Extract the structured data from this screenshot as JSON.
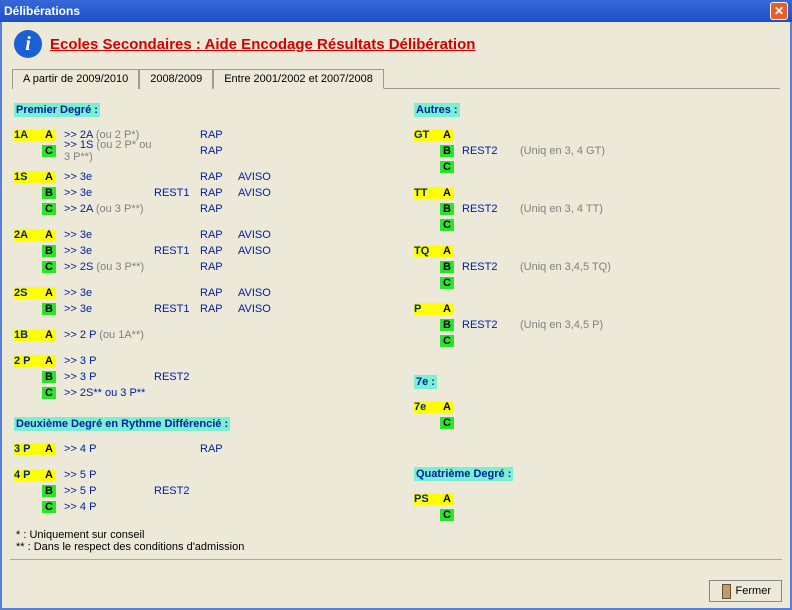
{
  "window": {
    "title": "Délibérations"
  },
  "header": {
    "title": "Ecoles Secondaires : Aide Encodage Résultats Délibération"
  },
  "tabs": {
    "t1": "A partir de 2009/2010",
    "t2": "2008/2009",
    "t3": "Entre 2001/2002 et 2007/2008"
  },
  "sections": {
    "premier": "Premier Degré :",
    "deuxieme": "Deuxième Degré en Rythme Différencié :",
    "autres": "Autres :",
    "septieme": "7e :",
    "quatrieme": "Quatrième Degré :"
  },
  "left": {
    "g1A_A": {
      "lvl": "1A",
      "L": "A",
      "dest": ">> 2A",
      "destgray": " (ou 2 P*)",
      "rest": "",
      "rap": "RAP",
      "av": ""
    },
    "g1A_C": {
      "lvl": "",
      "L": "C",
      "dest": ">> 1S",
      "destgray": " (ou 2 P* ou 3 P**)",
      "rest": "",
      "rap": "RAP",
      "av": ""
    },
    "g1S_A": {
      "lvl": "1S",
      "L": "A",
      "dest": ">> 3e",
      "destgray": "",
      "rest": "",
      "rap": "RAP",
      "av": "AVISO"
    },
    "g1S_B": {
      "lvl": "",
      "L": "B",
      "dest": ">> 3e",
      "destgray": "",
      "rest": "REST1",
      "rap": "RAP",
      "av": "AVISO"
    },
    "g1S_C": {
      "lvl": "",
      "L": "C",
      "dest": ">> 2A",
      "destgray": " (ou 3 P**)",
      "rest": "",
      "rap": "RAP",
      "av": ""
    },
    "g2A_A": {
      "lvl": "2A",
      "L": "A",
      "dest": ">> 3e",
      "destgray": "",
      "rest": "",
      "rap": "RAP",
      "av": "AVISO"
    },
    "g2A_B": {
      "lvl": "",
      "L": "B",
      "dest": ">> 3e",
      "destgray": "",
      "rest": "REST1",
      "rap": "RAP",
      "av": "AVISO"
    },
    "g2A_C": {
      "lvl": "",
      "L": "C",
      "dest": ">> 2S",
      "destgray": " (ou 3 P**)",
      "rest": "",
      "rap": "RAP",
      "av": ""
    },
    "g2S_A": {
      "lvl": "2S",
      "L": "A",
      "dest": ">> 3e",
      "destgray": "",
      "rest": "",
      "rap": "RAP",
      "av": "AVISO"
    },
    "g2S_B": {
      "lvl": "",
      "L": "B",
      "dest": ">> 3e",
      "destgray": "",
      "rest": "REST1",
      "rap": "RAP",
      "av": "AVISO"
    },
    "g1B_A": {
      "lvl": "1B",
      "L": "A",
      "dest": ">> 2 P",
      "destgray": " (ou 1A**)",
      "rest": "",
      "rap": "",
      "av": ""
    },
    "g2P_A": {
      "lvl": "2 P",
      "L": "A",
      "dest": ">> 3 P",
      "destgray": "",
      "rest": "",
      "rap": "",
      "av": ""
    },
    "g2P_B": {
      "lvl": "",
      "L": "B",
      "dest": ">> 3 P",
      "destgray": "",
      "rest": "REST2",
      "rap": "",
      "av": ""
    },
    "g2P_C": {
      "lvl": "",
      "L": "C",
      "dest": ">> 2S** ou 3 P**",
      "destgray": "",
      "rest": "",
      "rap": "",
      "av": ""
    },
    "g3P_A": {
      "lvl": "3 P",
      "L": "A",
      "dest": ">> 4 P",
      "destgray": "",
      "rest": "",
      "rap": "RAP",
      "av": ""
    },
    "g4P_A": {
      "lvl": "4 P",
      "L": "A",
      "dest": ">> 5 P",
      "destgray": "",
      "rest": "",
      "rap": "",
      "av": ""
    },
    "g4P_B": {
      "lvl": "",
      "L": "B",
      "dest": ">> 5 P",
      "destgray": "",
      "rest": "REST2",
      "rap": "",
      "av": ""
    },
    "g4P_C": {
      "lvl": "",
      "L": "C",
      "dest": ">> 4 P",
      "destgray": "",
      "rest": "",
      "rap": "",
      "av": ""
    }
  },
  "right": {
    "gGT_A": {
      "lvl": "GT",
      "L": "A",
      "rest": "",
      "note": ""
    },
    "gGT_B": {
      "lvl": "",
      "L": "B",
      "rest": "REST2",
      "note": "(Uniq en 3, 4 GT)"
    },
    "gGT_C": {
      "lvl": "",
      "L": "C",
      "rest": "",
      "note": ""
    },
    "gTT_A": {
      "lvl": "TT",
      "L": "A",
      "rest": "",
      "note": ""
    },
    "gTT_B": {
      "lvl": "",
      "L": "B",
      "rest": "REST2",
      "note": "(Uniq en 3, 4 TT)"
    },
    "gTT_C": {
      "lvl": "",
      "L": "C",
      "rest": "",
      "note": ""
    },
    "gTQ_A": {
      "lvl": "TQ",
      "L": "A",
      "rest": "",
      "note": ""
    },
    "gTQ_B": {
      "lvl": "",
      "L": "B",
      "rest": "REST2",
      "note": "(Uniq en 3,4,5 TQ)"
    },
    "gTQ_C": {
      "lvl": "",
      "L": "C",
      "rest": "",
      "note": ""
    },
    "gP_A": {
      "lvl": "P",
      "L": "A",
      "rest": "",
      "note": ""
    },
    "gP_B": {
      "lvl": "",
      "L": "B",
      "rest": "REST2",
      "note": "(Uniq en 3,4,5 P)"
    },
    "gP_C": {
      "lvl": "",
      "L": "C",
      "rest": "",
      "note": ""
    },
    "g7e_A": {
      "lvl": "7e",
      "L": "A",
      "rest": "",
      "note": ""
    },
    "g7e_C": {
      "lvl": "",
      "L": "C",
      "rest": "",
      "note": ""
    },
    "gPS_A": {
      "lvl": "PS",
      "L": "A",
      "rest": "",
      "note": ""
    },
    "gPS_C": {
      "lvl": "",
      "L": "C",
      "rest": "",
      "note": ""
    }
  },
  "footnotes": {
    "f1": "* : Uniquement sur conseil",
    "f2": "** : Dans le respect des conditions d'admission"
  },
  "buttons": {
    "close": "Fermer"
  }
}
